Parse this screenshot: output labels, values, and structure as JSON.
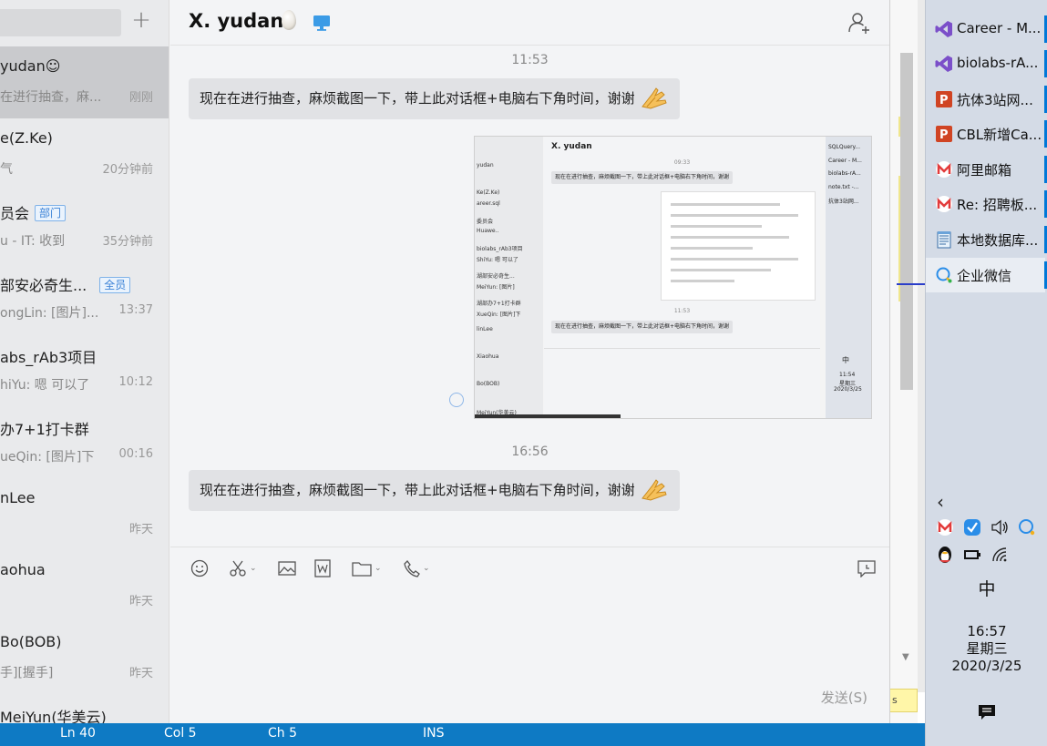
{
  "chat": {
    "title": "X. yudan",
    "conversations": [
      {
        "name": "yudan",
        "preview": "在进行抽查，麻...",
        "time": "刚刚",
        "active": true
      },
      {
        "name": "e(Z.Ke)",
        "preview": "气",
        "time": "20分钟前"
      },
      {
        "name": "员会",
        "tag": "部门",
        "preview": "u - IT: 收到",
        "time": "35分钟前"
      },
      {
        "name": "部安必奇生...",
        "tag": "全员",
        "preview": "ongLin: [图片]...",
        "time": "13:37"
      },
      {
        "name": "abs_rAb3项目",
        "preview": "hiYu: 嗯 可以了",
        "time": "10:12"
      },
      {
        "name": "办7+1打卡群",
        "preview": "ueQin: [图片]下",
        "time": "00:16"
      },
      {
        "name": "nLee",
        "preview": "",
        "time": "昨天"
      },
      {
        "name": "aohua",
        "preview": "",
        "time": "昨天"
      },
      {
        "name": "Bo(BOB)",
        "preview": "手][握手]",
        "time": "昨天"
      },
      {
        "name": "MeiYun(华美云)",
        "preview": "",
        "time": ""
      }
    ],
    "messages": [
      {
        "time": "11:53",
        "text": "现在在进行抽查，麻烦截图一下，带上此对话框+电脑右下角时间，谢谢"
      },
      {
        "time": "16:56",
        "text": "现在在进行抽查，麻烦截图一下，带上此对话框+电脑右下角时间，谢谢"
      }
    ],
    "send_label": "发送(S)",
    "screenshot": {
      "title": "X. yudan",
      "time": "09:33",
      "time2": "11:53",
      "bubble": "现在在进行抽查，麻烦截图一下，带上此对话框+电脑右下角时间，谢谢",
      "side_items": [
        "yudan",
        "Ke(Z.Ke)",
        "areer.sql",
        "委员会",
        "Huawe..",
        "biolabs_rAb3项目",
        "ShiYu: 嗯 可以了",
        "湖部安必奇生...",
        "MeiYun: [图片]",
        "湖部办7+1打卡群",
        "XueQin: [图片]下",
        "linLee",
        "Xiaohua",
        "Bo(BOB)",
        "MeiYun(华美云)"
      ],
      "task_items": [
        "SQLQuery...",
        "Career - M...",
        "biolabs-rA...",
        "note.txt -...",
        "抗体3站网..."
      ],
      "clock_time": "11:54",
      "clock_day": "星期三",
      "clock_date": "2020/3/25",
      "ime": "中"
    }
  },
  "editor_status": {
    "ln": "Ln 40",
    "col": "Col 5",
    "ch": "Ch 5",
    "ins": "INS",
    "strip": "s"
  },
  "taskbar": {
    "items": [
      {
        "label": "Career - M...",
        "icon": "visual-studio-icon"
      },
      {
        "label": "biolabs-rA...",
        "icon": "visual-studio-icon"
      },
      {
        "label": "抗体3站网...",
        "icon": "powerpoint-icon"
      },
      {
        "label": "CBL新增Ca...",
        "icon": "powerpoint-icon"
      },
      {
        "label": "阿里邮箱",
        "icon": "aliyun-mail-icon"
      },
      {
        "label": "Re: 招聘板...",
        "icon": "aliyun-mail-icon"
      },
      {
        "label": "本地数据库...",
        "icon": "notepad-icon"
      },
      {
        "label": "企业微信",
        "icon": "wecom-icon",
        "active": true
      }
    ],
    "ime": "中",
    "clock_time": "16:57",
    "clock_day": "星期三",
    "clock_date": "2020/3/25"
  },
  "colors": {
    "accent_blue": "#0078d7",
    "statusbar": "#0e7ac4",
    "tag_blue": "#3b82d6",
    "visual_studio": "#7b4fc9",
    "powerpoint": "#d04423",
    "mail_red": "#e23b3b"
  }
}
